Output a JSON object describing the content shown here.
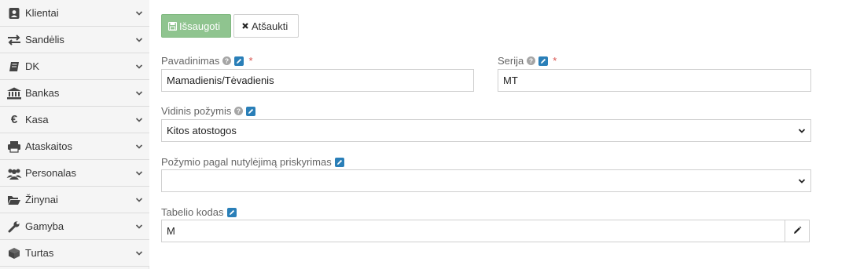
{
  "sidebar": {
    "items": [
      {
        "label": "Klientai",
        "icon": "address-card-icon"
      },
      {
        "label": "Sandėlis",
        "icon": "exchange-icon"
      },
      {
        "label": "DK",
        "icon": "book-icon"
      },
      {
        "label": "Bankas",
        "icon": "bank-icon"
      },
      {
        "label": "Kasa",
        "icon": "euro-icon"
      },
      {
        "label": "Ataskaitos",
        "icon": "printer-icon"
      },
      {
        "label": "Personalas",
        "icon": "users-icon"
      },
      {
        "label": "Žinynai",
        "icon": "folder-open-icon"
      },
      {
        "label": "Gamyba",
        "icon": "wrench-icon"
      },
      {
        "label": "Turtas",
        "icon": "cube-icon"
      }
    ]
  },
  "toolbar": {
    "save_label": "Išsaugoti",
    "cancel_label": "Atšaukti"
  },
  "form": {
    "name": {
      "label": "Pavadinimas",
      "value": "Mamadienis/Tėvadienis",
      "required_mark": "*"
    },
    "series": {
      "label": "Serija",
      "value": "MT",
      "required_mark": "*"
    },
    "internal_attr": {
      "label": "Vidinis požymis",
      "value": "Kitos atostogos"
    },
    "default_attr": {
      "label": "Požymio pagal nutylėjimą priskyrimas",
      "value": ""
    },
    "timesheet_code": {
      "label": "Tabelio kodas",
      "value": "M"
    }
  },
  "colors": {
    "save_button": "#8fc48f",
    "edit_badge": "#2a7fb8",
    "required": "#d9534f",
    "help_icon": "#a5a5a5"
  }
}
